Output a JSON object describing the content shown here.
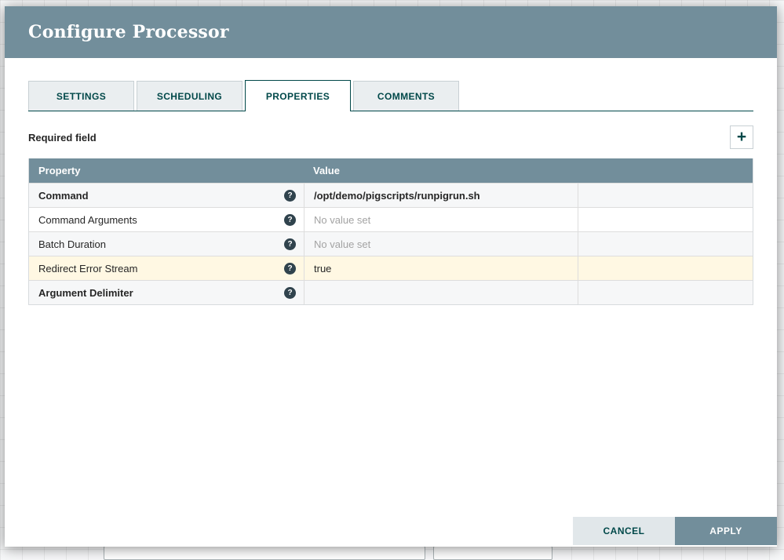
{
  "dialog": {
    "title": "Configure Processor",
    "tabs": [
      {
        "label": "SETTINGS",
        "active": false
      },
      {
        "label": "SCHEDULING",
        "active": false
      },
      {
        "label": "PROPERTIES",
        "active": true
      },
      {
        "label": "COMMENTS",
        "active": false
      }
    ],
    "required_field_label": "Required field",
    "table": {
      "columns": {
        "property": "Property",
        "value": "Value"
      },
      "rows": [
        {
          "property": "Command",
          "value": "/opt/demo/pigscripts/runpigrun.sh",
          "required": true,
          "placeholder": false,
          "highlight": false
        },
        {
          "property": "Command Arguments",
          "value": "No value set",
          "required": false,
          "placeholder": true,
          "highlight": false
        },
        {
          "property": "Batch Duration",
          "value": "No value set",
          "required": false,
          "placeholder": true,
          "highlight": false
        },
        {
          "property": "Redirect Error Stream",
          "value": "true",
          "required": false,
          "placeholder": false,
          "highlight": true
        },
        {
          "property": "Argument Delimiter",
          "value": "",
          "required": true,
          "placeholder": false,
          "highlight": false
        }
      ]
    },
    "buttons": {
      "cancel": "CANCEL",
      "apply": "APPLY"
    }
  },
  "icons": {
    "help": "?",
    "add": "+"
  },
  "colors": {
    "accent": "#004849",
    "header_bg": "#728e9b",
    "table_header_bg": "#728e9b",
    "highlight_row": "#fff8e3",
    "inactive_tab_bg": "#eaeef0",
    "cancel_bg": "#e1e7ea"
  }
}
